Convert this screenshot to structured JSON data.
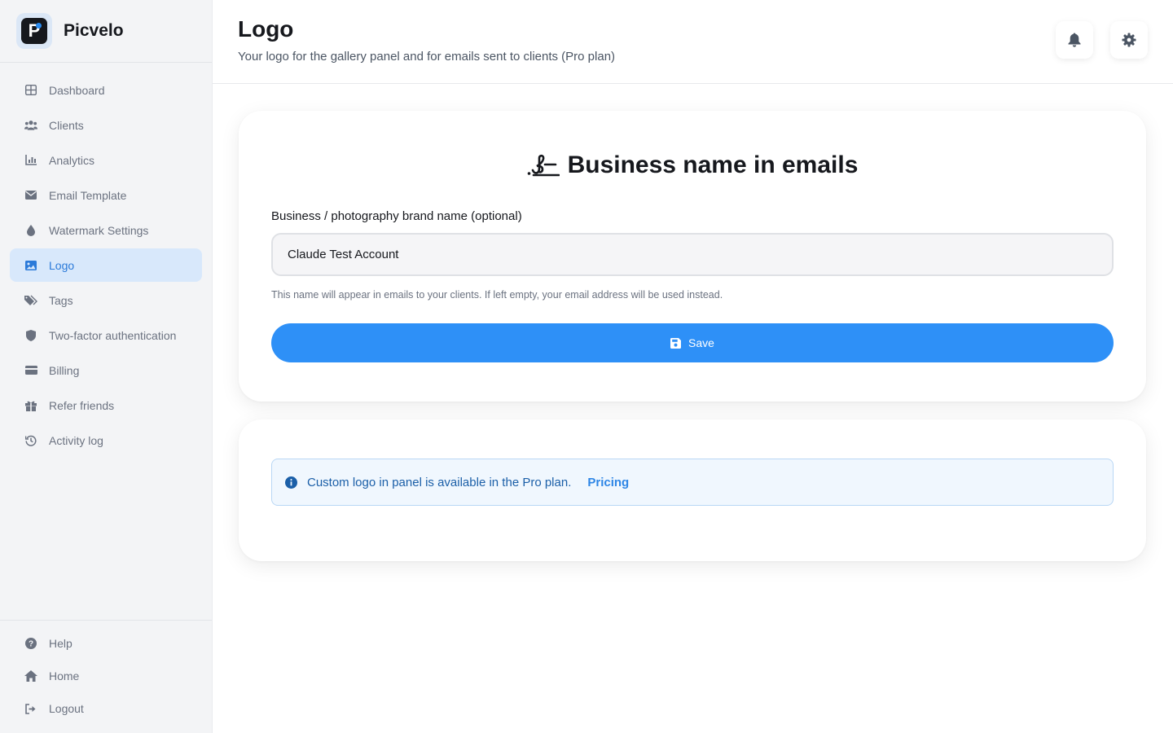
{
  "brand": {
    "name": "Picvelo",
    "logo_letter": "P"
  },
  "sidebar": {
    "items": [
      {
        "label": "Dashboard",
        "icon": "dashboard-icon"
      },
      {
        "label": "Clients",
        "icon": "users-icon"
      },
      {
        "label": "Analytics",
        "icon": "chart-icon"
      },
      {
        "label": "Email Template",
        "icon": "envelope-icon"
      },
      {
        "label": "Watermark Settings",
        "icon": "droplet-icon"
      },
      {
        "label": "Logo",
        "icon": "image-icon",
        "active": true
      },
      {
        "label": "Tags",
        "icon": "tags-icon"
      },
      {
        "label": "Two-factor authentication",
        "icon": "shield-icon"
      },
      {
        "label": "Billing",
        "icon": "credit-card-icon"
      },
      {
        "label": "Refer friends",
        "icon": "gift-icon"
      },
      {
        "label": "Activity log",
        "icon": "history-icon"
      }
    ],
    "bottom_items": [
      {
        "label": "Help",
        "icon": "question-icon"
      },
      {
        "label": "Home",
        "icon": "home-icon"
      },
      {
        "label": "Logout",
        "icon": "logout-icon"
      }
    ]
  },
  "header": {
    "title": "Logo",
    "subtitle": "Your logo for the gallery panel and for emails sent to clients (Pro plan)"
  },
  "business_card": {
    "title": "Business name in emails",
    "title_icon": "signature-icon",
    "field_label": "Business / photography brand name (optional)",
    "field_value": "Claude Test Account",
    "help_text": "This name will appear in emails to your clients. If left empty, your email address will be used instead.",
    "save_label": "Save"
  },
  "logo_card": {
    "alert_text": "Custom logo in panel is available in the Pro plan.",
    "alert_link": "Pricing"
  },
  "colors": {
    "accent": "#2e90f7",
    "active_nav_bg": "#d8e8fb",
    "alert_bg": "#f0f7fe"
  }
}
